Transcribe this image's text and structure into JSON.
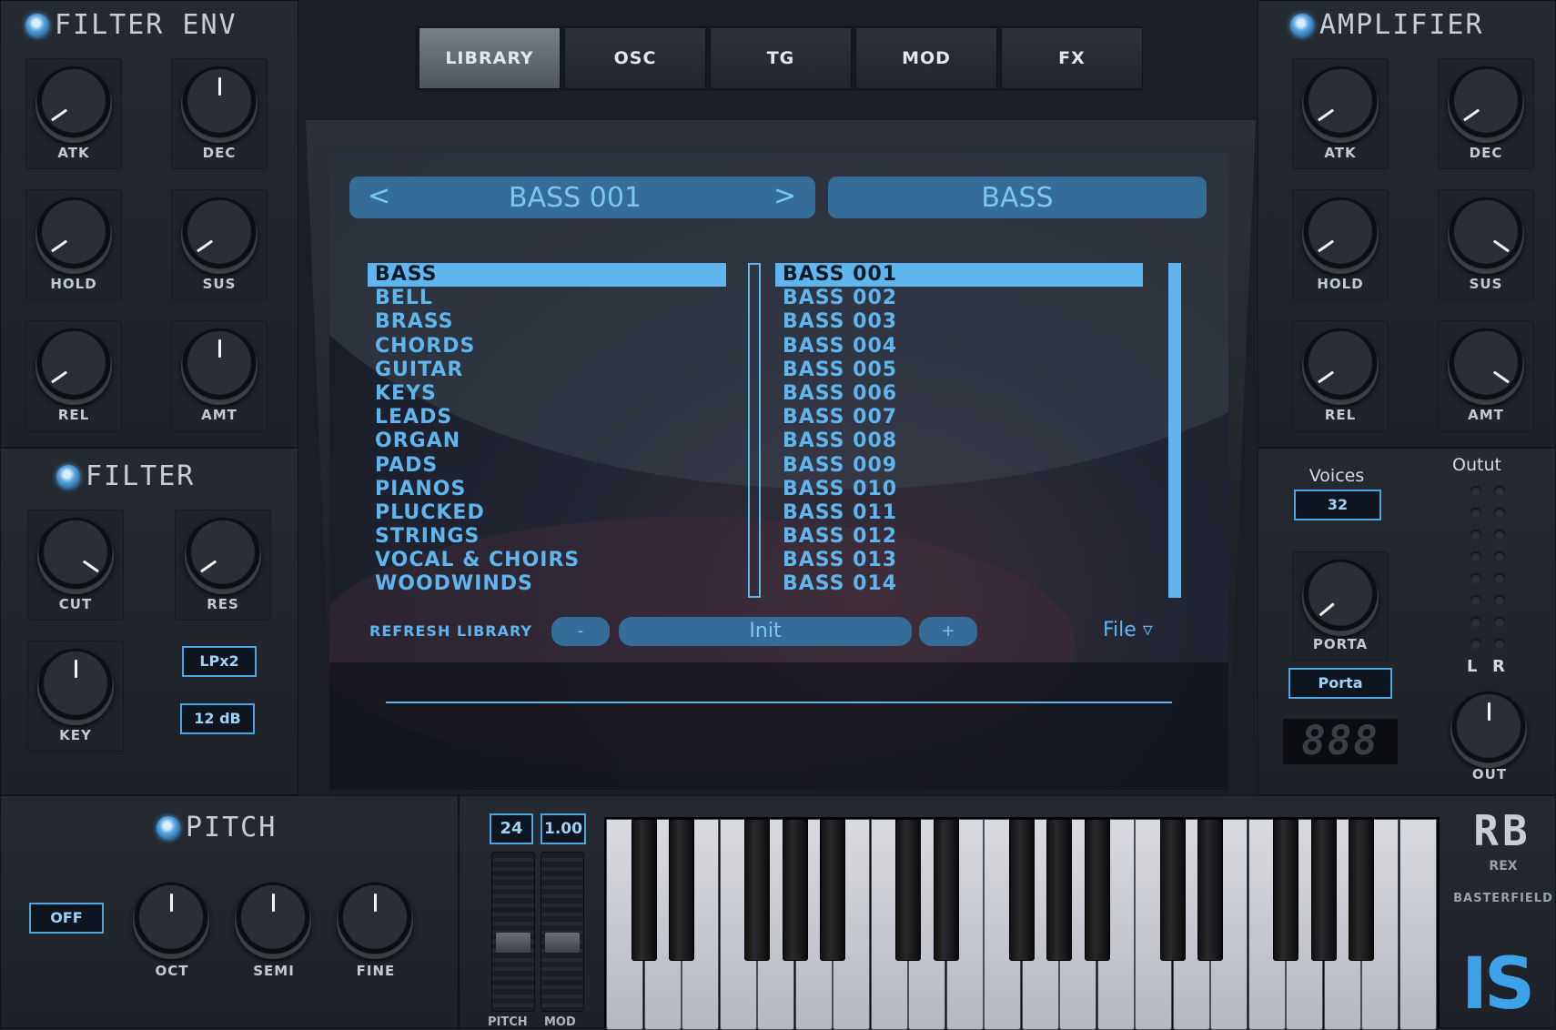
{
  "tabs": [
    {
      "label": "LIBRARY",
      "active": true
    },
    {
      "label": "OSC",
      "active": false
    },
    {
      "label": "TG",
      "active": false
    },
    {
      "label": "MOD",
      "active": false
    },
    {
      "label": "FX",
      "active": false
    }
  ],
  "filter_env": {
    "title": "FILTER ENV",
    "knobs": [
      "ATK",
      "DEC",
      "HOLD",
      "SUS",
      "REL",
      "AMT"
    ]
  },
  "filter": {
    "title": "FILTER",
    "knobs": [
      "CUT",
      "RES",
      "KEY"
    ],
    "mode": "LPx2",
    "slope": "12 dB"
  },
  "amplifier": {
    "title": "AMPLIFIER",
    "knobs": [
      "ATK",
      "DEC",
      "HOLD",
      "SUS",
      "REL",
      "AMT"
    ]
  },
  "voices": {
    "label": "Voices",
    "value": "32",
    "porta_label": "PORTA",
    "porta_button": "Porta",
    "display": "888"
  },
  "output": {
    "label": "Outut",
    "l": "L",
    "r": "R",
    "knob": "OUT"
  },
  "pitch": {
    "title": "PITCH",
    "toggle": "OFF",
    "knobs": [
      "OCT",
      "SEMI",
      "FINE"
    ]
  },
  "wheels": {
    "range": "24",
    "value": "1.00",
    "pitch_label": "PITCH",
    "mod_label": "MOD"
  },
  "library": {
    "prev": "<",
    "next": ">",
    "preset_name": "BASS 001",
    "category_name": "BASS",
    "categories": [
      "BASS",
      "BELL",
      "BRASS",
      "CHORDS",
      "GUITAR",
      "KEYS",
      "LEADS",
      "ORGAN",
      "PADS",
      "PIANOS",
      "PLUCKED",
      "STRINGS",
      "VOCAL & CHOIRS",
      "WOODWINDS"
    ],
    "presets": [
      "BASS 001",
      "BASS 002",
      "BASS 003",
      "BASS 004",
      "BASS 005",
      "BASS 006",
      "BASS 007",
      "BASS 008",
      "BASS 009",
      "BASS 010",
      "BASS 011",
      "BASS 012",
      "BASS 013",
      "BASS 014"
    ],
    "refresh": "REFRESH LIBRARY",
    "minus": "-",
    "init": "Init",
    "plus": "+",
    "file": "File ▿"
  },
  "brand": {
    "logo": "RB",
    "sub1": "REX",
    "sub2": "BASTERFIELD",
    "corner": "IS"
  },
  "colors": {
    "accent": "#5fb6ef",
    "panel": "#22262c",
    "selection": "#5fb6ef"
  }
}
